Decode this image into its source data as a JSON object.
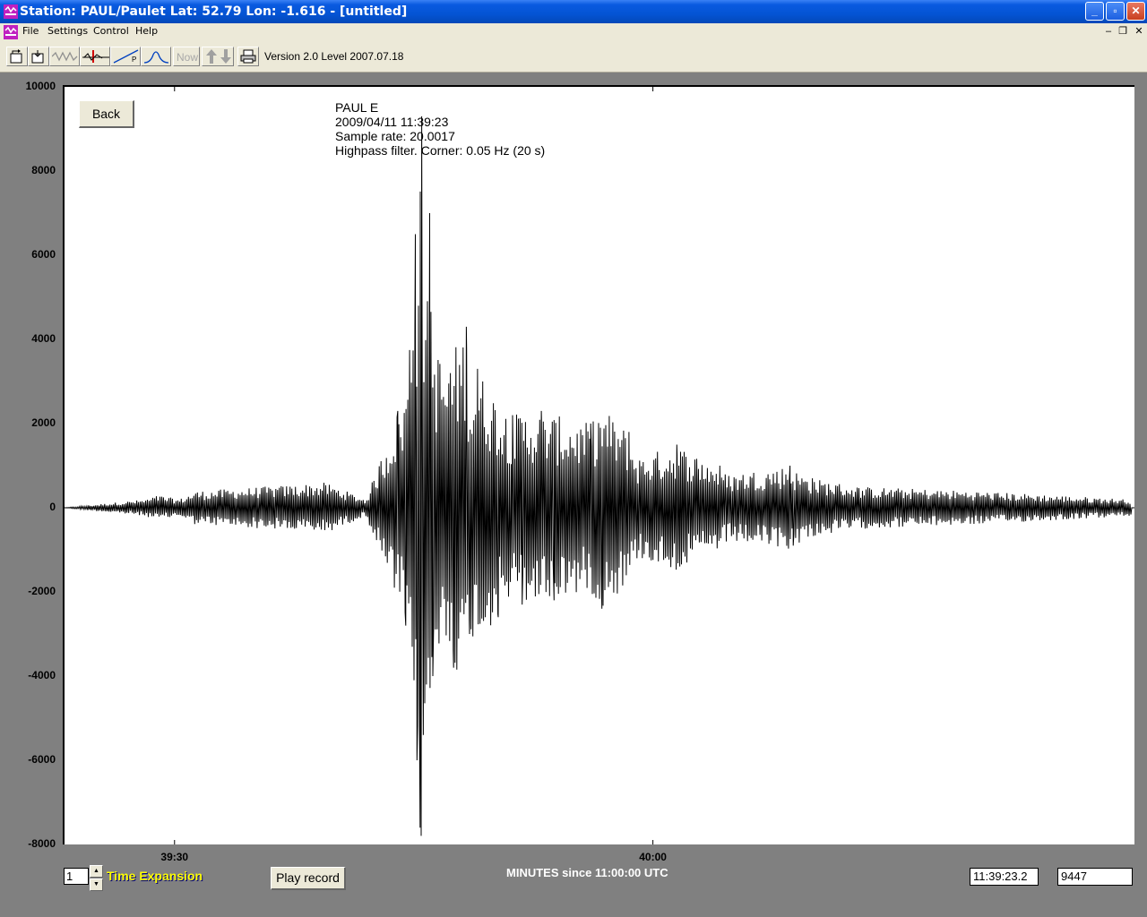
{
  "window": {
    "title": "Station: PAUL/Paulet Lat: 52.79 Lon: -1.616 - [untitled]",
    "minimize_label": "_",
    "maximize_label": "▫",
    "close_label": "✕"
  },
  "menu": {
    "items": [
      "File",
      "Settings",
      "Control",
      "Help"
    ],
    "mdi_minimize": "–",
    "mdi_restore": "❐",
    "mdi_close": "✕"
  },
  "toolbar": {
    "now_label": "Now",
    "version": "Version 2.0 Level 2007.07.18"
  },
  "plot": {
    "back_label": "Back",
    "info": [
      "PAUL  E",
      "2009/04/11 11:39:23",
      "Sample rate: 20.0017",
      "Highpass filter. Corner: 0.05 Hz (20 s)"
    ]
  },
  "controls": {
    "expansion_value": "1",
    "expansion_label": "Time Expansion",
    "play_label": "Play record",
    "time_readout": "11:39:23.2",
    "value_readout": "9447"
  },
  "colors": {
    "title_bar": "#0454d4",
    "background": "#808080",
    "trace": "#000000",
    "expansion_label": "#ffff00"
  },
  "chart_data": {
    "type": "line",
    "title": "",
    "xlabel": "MINUTES since 11:00:00 UTC",
    "ylabel": "",
    "ylim": [
      -8000,
      10000
    ],
    "yticks": [
      10000,
      8000,
      6000,
      4000,
      2000,
      0,
      -2000,
      -4000,
      -6000,
      -8000
    ],
    "xlim_seconds": [
      2363.1,
      2430.2
    ],
    "xticks": [
      {
        "label": "39:30",
        "t": 2370
      },
      {
        "label": "40:00",
        "t": 2400
      }
    ],
    "series": [
      {
        "keypoints": [
          [
            2363.1,
            0
          ],
          [
            2368.2,
            200
          ],
          [
            2369.0,
            -300
          ],
          [
            2370.3,
            200
          ],
          [
            2371.3,
            -400
          ],
          [
            2371.5,
            400
          ],
          [
            2375.6,
            500
          ],
          [
            2379.5,
            600
          ],
          [
            2382.0,
            -200
          ],
          [
            2384.0,
            2300
          ],
          [
            2384.5,
            -2800
          ],
          [
            2385.1,
            6500
          ],
          [
            2385.2,
            -6000
          ],
          [
            2385.3,
            4800
          ],
          [
            2385.4,
            -7600
          ],
          [
            2385.5,
            9300
          ],
          [
            2385.6,
            -5400
          ],
          [
            2385.8,
            -4200
          ],
          [
            2386.0,
            7000
          ],
          [
            2386.2,
            -4000
          ],
          [
            2387.3,
            3200
          ],
          [
            2387.5,
            -3800
          ],
          [
            2388.3,
            4300
          ],
          [
            2388.5,
            -3000
          ],
          [
            2389.0,
            3300
          ],
          [
            2390.3,
            -2600
          ],
          [
            2391.2,
            2200
          ],
          [
            2391.8,
            -2300
          ],
          [
            2393.0,
            2300
          ],
          [
            2393.8,
            -2200
          ],
          [
            2396.1,
            2000
          ],
          [
            2396.8,
            -2400
          ],
          [
            2398.5,
            1800
          ],
          [
            2399.0,
            -1200
          ],
          [
            2401.5,
            1500
          ],
          [
            2404.2,
            1000
          ],
          [
            2404.6,
            -800
          ],
          [
            2408.6,
            1000
          ],
          [
            2408.8,
            -900
          ],
          [
            2410.0,
            700
          ],
          [
            2413.0,
            500
          ],
          [
            2420.0,
            400
          ],
          [
            2430.0,
            200
          ]
        ]
      }
    ]
  }
}
